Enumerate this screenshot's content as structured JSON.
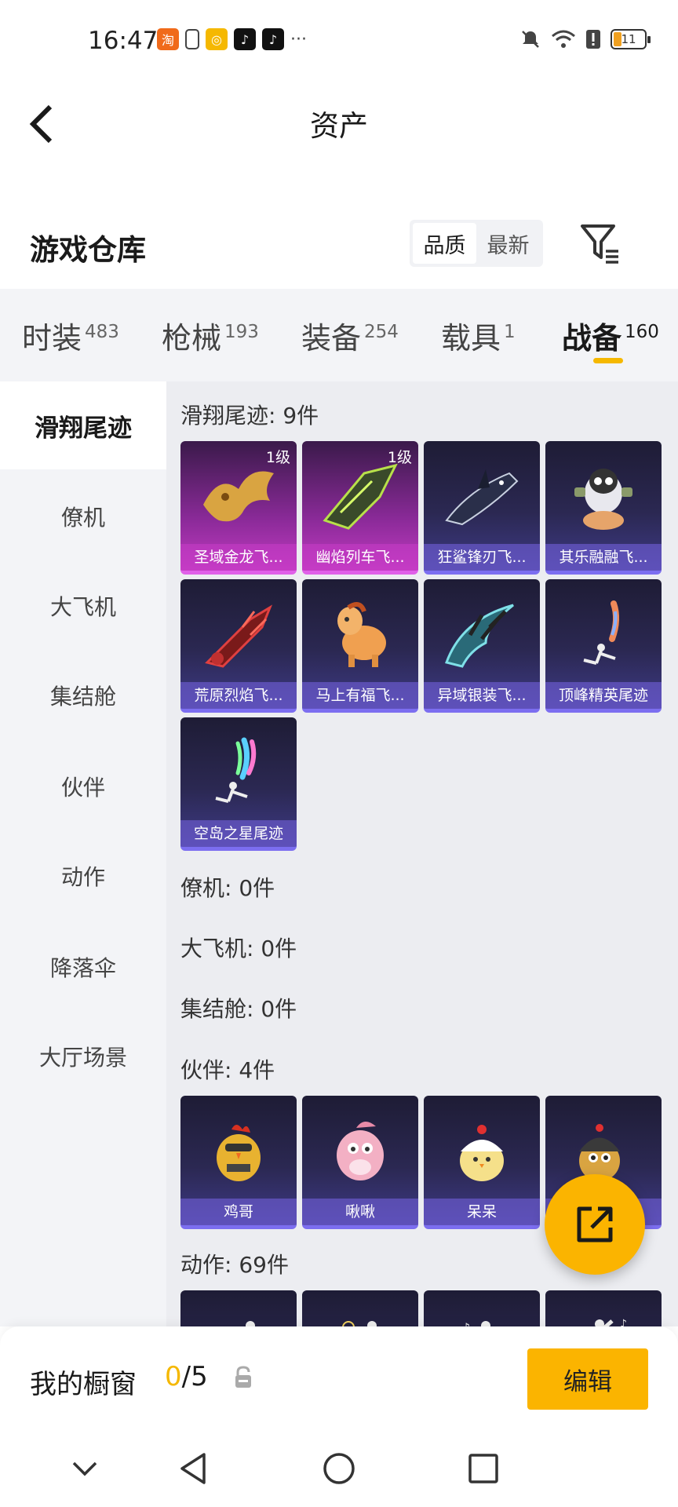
{
  "status_bar": {
    "time": "16:47",
    "battery": "11"
  },
  "header": {
    "title": "资产"
  },
  "warehouse": {
    "title": "游戏仓库",
    "sort_options": [
      "品质",
      "最新"
    ],
    "active_sort": "品质"
  },
  "tabs": [
    {
      "label": "时装",
      "count": "483"
    },
    {
      "label": "枪械",
      "count": "193"
    },
    {
      "label": "装备",
      "count": "254"
    },
    {
      "label": "载具",
      "count": "1"
    },
    {
      "label": "战备",
      "count": "160",
      "active": true
    }
  ],
  "sidebar": {
    "items": [
      {
        "label": "滑翔尾迹",
        "active": true
      },
      {
        "label": "僚机"
      },
      {
        "label": "大飞机"
      },
      {
        "label": "集结舱"
      },
      {
        "label": "伙伴"
      },
      {
        "label": "动作"
      },
      {
        "label": "降落伞"
      },
      {
        "label": "大厅场景"
      }
    ]
  },
  "sections": {
    "glide_trail": {
      "label": "滑翔尾迹: 9件",
      "items": [
        {
          "name": "圣域金龙飞...",
          "level": "1级",
          "rarity": "purple",
          "icon": "golden-dragon-icon"
        },
        {
          "name": "幽焰列车飞...",
          "level": "1级",
          "rarity": "purple",
          "icon": "flame-train-icon"
        },
        {
          "name": "狂鲨锋刃飞...",
          "rarity": "blue",
          "icon": "shark-blade-icon"
        },
        {
          "name": "其乐融融飞...",
          "rarity": "blue",
          "icon": "penguin-icon"
        },
        {
          "name": "荒原烈焰飞...",
          "rarity": "blue",
          "icon": "wasteland-flame-icon"
        },
        {
          "name": "马上有福飞...",
          "rarity": "blue",
          "icon": "horse-icon"
        },
        {
          "name": "异域银装飞...",
          "rarity": "blue",
          "icon": "silver-wing-icon"
        },
        {
          "name": "顶峰精英尾迹",
          "rarity": "blue",
          "icon": "elite-trail-icon"
        },
        {
          "name": "空岛之星尾迹",
          "rarity": "blue",
          "icon": "sky-star-trail-icon"
        }
      ]
    },
    "wingman": {
      "label": "僚机: 0件"
    },
    "big_plane": {
      "label": "大飞机: 0件"
    },
    "pod": {
      "label": "集结舱: 0件"
    },
    "partner": {
      "label": "伙伴: 4件",
      "items": [
        {
          "name": "鸡哥",
          "icon": "chicken-icon"
        },
        {
          "name": "啾啾",
          "icon": "pink-bird-icon"
        },
        {
          "name": "呆呆",
          "icon": "chick-icon"
        },
        {
          "name": "",
          "icon": "helmet-chick-icon"
        }
      ]
    },
    "action": {
      "label": "动作: 69件"
    }
  },
  "bottom_bar": {
    "showcase_label": "我的橱窗",
    "showcase_current": "0",
    "showcase_total": "/5",
    "edit_label": "编辑"
  },
  "colors": {
    "accent": "#fbb400",
    "tab_underline": "#f5b800"
  }
}
